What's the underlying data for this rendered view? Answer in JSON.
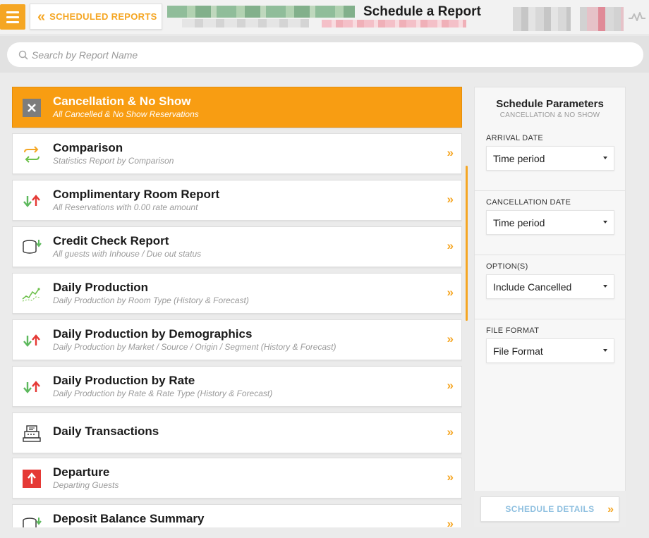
{
  "header": {
    "back_label": "SCHEDULED REPORTS",
    "back_chevron": "«",
    "page_title": "Schedule a Report"
  },
  "search": {
    "placeholder": "Search by Report Name"
  },
  "reports": [
    {
      "title": "Cancellation & No Show",
      "subtitle": "All Cancelled & No Show Reservations",
      "icon": "close-icon",
      "active": true
    },
    {
      "title": "Comparison",
      "subtitle": "Statistics Report by Comparison",
      "icon": "swap-arrows-icon"
    },
    {
      "title": "Complimentary Room Report",
      "subtitle": "All Reservations with 0.00 rate amount",
      "icon": "up-down-arrows-icon"
    },
    {
      "title": "Credit Check Report",
      "subtitle": "All guests with Inhouse / Due out status",
      "icon": "coin-stack-icon"
    },
    {
      "title": "Daily Production",
      "subtitle": "Daily Production by Room Type (History & Forecast)",
      "icon": "trend-chart-icon"
    },
    {
      "title": "Daily Production by Demographics",
      "subtitle": "Daily Production by Market / Source / Origin / Segment (History & Forecast)",
      "icon": "up-down-arrows-icon"
    },
    {
      "title": "Daily Production by Rate",
      "subtitle": "Daily Production by Rate & Rate Type (History & Forecast)",
      "icon": "up-down-arrows-icon"
    },
    {
      "title": "Daily Transactions",
      "subtitle": "",
      "icon": "cash-register-icon"
    },
    {
      "title": "Departure",
      "subtitle": "Departing Guests",
      "icon": "up-arrow-box-icon"
    },
    {
      "title": "Deposit Balance Summary",
      "subtitle": "",
      "icon": "coin-stack-icon"
    }
  ],
  "row_arrow": "»",
  "panel": {
    "title": "Schedule Parameters",
    "subtitle": "CANCELLATION & NO SHOW",
    "params": [
      {
        "label": "ARRIVAL DATE",
        "value": "Time period"
      },
      {
        "label": "CANCELLATION DATE",
        "value": "Time period"
      },
      {
        "label": "OPTION(S)",
        "value": "Include Cancelled"
      },
      {
        "label": "FILE FORMAT",
        "value": "File Format"
      }
    ],
    "footer_button": "SCHEDULE DETAILS",
    "footer_arrow": "»"
  },
  "colors": {
    "accent": "#f5a623",
    "active_row": "#f89d12",
    "link_blue": "#8fc0e0",
    "arrow_red": "#e53935",
    "arrow_green": "#5cb85c"
  }
}
